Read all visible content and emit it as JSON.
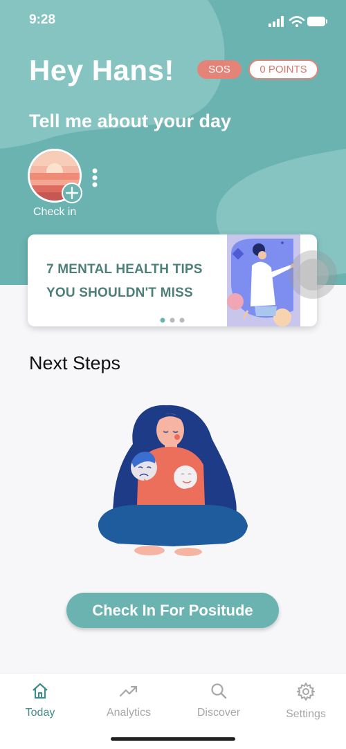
{
  "status_bar": {
    "time": "9:28"
  },
  "header": {
    "greeting": "Hey Hans!",
    "sos_label": "SOS",
    "points_label": "0 POINTS",
    "subtitle": "Tell me about your day"
  },
  "check_in": {
    "label": "Check in"
  },
  "tip_card": {
    "line_1": "7 MENTAL HEALTH TIPS",
    "line_2": "YOU SHOULDN'T MISS",
    "page_index": 1,
    "page_count": 3
  },
  "next_steps": {
    "title": "Next Steps",
    "button_label": "Check In For Positude"
  },
  "tab_bar": {
    "items": [
      {
        "label": "Today",
        "icon": "home-icon",
        "active": true
      },
      {
        "label": "Analytics",
        "icon": "trend-up-icon",
        "active": false
      },
      {
        "label": "Discover",
        "icon": "search-icon",
        "active": false
      },
      {
        "label": "Settings",
        "icon": "gear-icon",
        "active": false
      }
    ]
  },
  "colors": {
    "primary_teal": "#6bb3b1",
    "sos_coral": "#e48478",
    "tip_text": "#4d7f78",
    "active_tab": "#3f8c8a",
    "inactive_tab": "#a7a7a7"
  }
}
